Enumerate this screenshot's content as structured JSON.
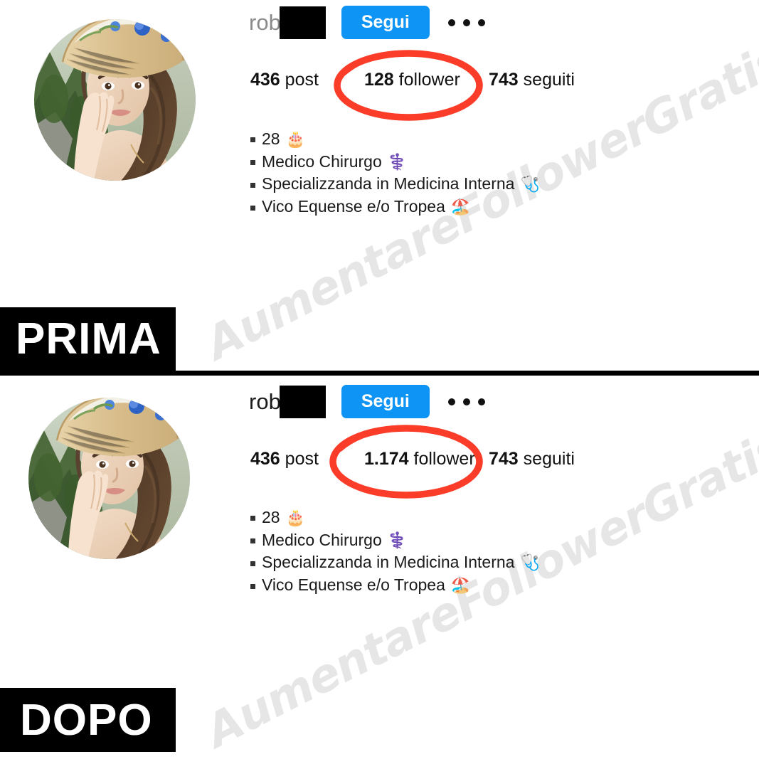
{
  "watermark": {
    "text": "AumentareFollowerGratis",
    "color": "#e6e6e6"
  },
  "colors": {
    "follow_button": "#0d94f4",
    "annotation_circle": "#fa3c28",
    "label_background": "#000000",
    "username_gray": "#8a8a8a"
  },
  "panels": [
    {
      "id": "before",
      "label": "PRIMA",
      "profile": {
        "username_prefix": "rob",
        "username_redacted": true,
        "follow_button_label": "Segui",
        "more_options_icon": "ellipsis-icon",
        "avatar_alt": "profile-photo-woman-straw-hat",
        "stats": [
          {
            "key": "posts",
            "value": "436",
            "label": "post"
          },
          {
            "key": "followers",
            "value": "128",
            "label": "follower",
            "highlighted": true
          },
          {
            "key": "following",
            "value": "743",
            "label": "seguiti"
          }
        ],
        "bio": [
          {
            "text": "28",
            "emoji": "🎂",
            "emoji_name": "birthday-cake-emoji"
          },
          {
            "text": "Medico Chirurgo",
            "emoji": "⚕️",
            "emoji_name": "medical-symbol-emoji"
          },
          {
            "text": "Specializzanda in Medicina Interna",
            "emoji": "🩺",
            "emoji_name": "stethoscope-emoji"
          },
          {
            "text": "Vico Equense e/o Tropea",
            "emoji": "🏖️",
            "emoji_name": "beach-umbrella-emoji"
          }
        ]
      }
    },
    {
      "id": "after",
      "label": "DOPO",
      "profile": {
        "username_prefix": "rob",
        "username_redacted": true,
        "follow_button_label": "Segui",
        "more_options_icon": "ellipsis-icon",
        "avatar_alt": "profile-photo-woman-straw-hat",
        "stats": [
          {
            "key": "posts",
            "value": "436",
            "label": "post"
          },
          {
            "key": "followers",
            "value": "1.174",
            "label": "follower",
            "highlighted": true
          },
          {
            "key": "following",
            "value": "743",
            "label": "seguiti"
          }
        ],
        "bio": [
          {
            "text": "28",
            "emoji": "🎂",
            "emoji_name": "birthday-cake-emoji"
          },
          {
            "text": "Medico Chirurgo",
            "emoji": "⚕️",
            "emoji_name": "medical-symbol-emoji"
          },
          {
            "text": "Specializzanda in Medicina Interna",
            "emoji": "🩺",
            "emoji_name": "stethoscope-emoji"
          },
          {
            "text": "Vico Equense e/o Tropea",
            "emoji": "🏖️",
            "emoji_name": "beach-umbrella-emoji"
          }
        ]
      }
    }
  ]
}
